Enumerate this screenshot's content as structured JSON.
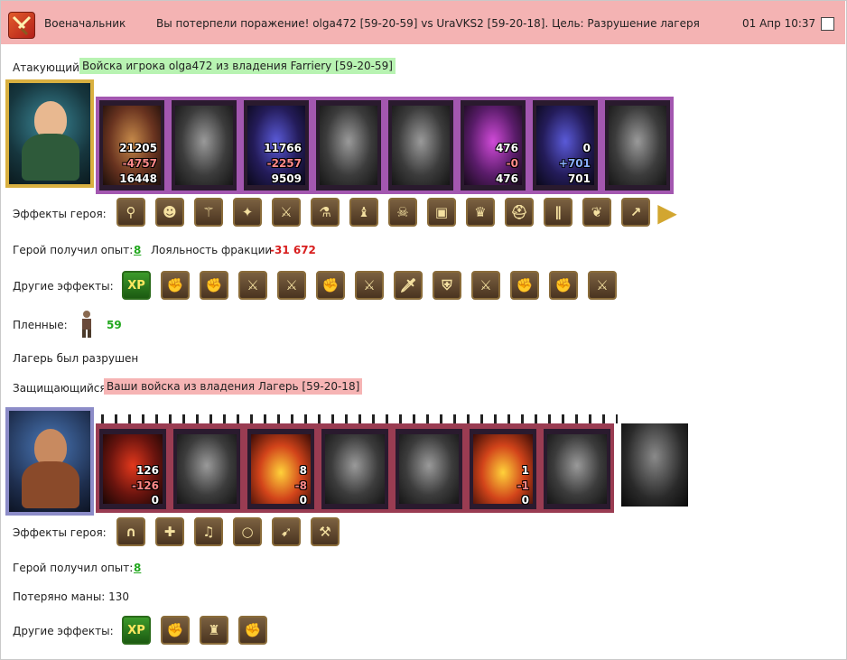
{
  "header": {
    "title": "Военачальник",
    "message": "Вы потерпели поражение! olga472 [59-20-59] vs UraVKS2 [59-20-18]. Цель: Разрушение лагеря",
    "time": "01 Апр 10:37"
  },
  "attacker": {
    "label": "Атакующий",
    "tag": "Войска игрока olga472 из владения Farriery [59-20-59]",
    "units": [
      {
        "icon": "ogre-unit-icon",
        "tone": "col",
        "a": "21205",
        "b": "-4757",
        "c": "16448"
      },
      {
        "icon": "dark-knight-unit-icon",
        "tone": "",
        "a": "",
        "b": "",
        "c": ""
      },
      {
        "icon": "dragon-rider-unit-icon",
        "tone": "blu",
        "a": "11766",
        "b": "-2257",
        "c": "9509"
      },
      {
        "icon": "griffin-unit-icon",
        "tone": "",
        "a": "",
        "b": "",
        "c": ""
      },
      {
        "icon": "archer-unit-icon",
        "tone": "",
        "a": "",
        "b": "",
        "c": ""
      },
      {
        "icon": "sorceress-unit-icon",
        "tone": "pur",
        "a": "476",
        "b": "-0",
        "c": "476"
      },
      {
        "icon": "assassin-unit-icon",
        "tone": "blu",
        "a": "0",
        "b": "+701",
        "c": "701"
      },
      {
        "icon": "horseman-unit-icon",
        "tone": "",
        "a": "",
        "b": "",
        "c": ""
      }
    ],
    "hero_effects_label": "Эффекты героя:",
    "hero_effects": [
      "boots-icon",
      "mask-icon",
      "staff-icon",
      "crystal-icon",
      "sword-icon",
      "potion-icon",
      "totem-icon",
      "skull-icon",
      "chest-icon",
      "crown-icon",
      "helm-icon",
      "legs-icon",
      "wings-icon",
      "spear-icon"
    ],
    "exp_label": "Герой получил опыт:",
    "exp_value": "8",
    "loyalty_label": "Лояльность фракции",
    "loyalty_value": "-31 672",
    "other_effects_label": "Другие эффекты:",
    "other_effects": [
      "xp",
      "fist-sword-icon",
      "fist-sword-icon",
      "sword-icon",
      "sword-icon",
      "fist-sword-icon",
      "sword-icon",
      "green-sword-icon",
      "shield-icon",
      "sword-icon",
      "fist-sword-icon",
      "fist-sword-icon",
      "sword-icon"
    ],
    "prisoners_label": "Пленные:",
    "prisoners_value": "59",
    "camp_text": "Лагерь был разрушен"
  },
  "defender": {
    "label": "Защищающийся",
    "tag": "Ваши войска из владения Лагерь [59-20-18]",
    "units": [
      {
        "icon": "red-demon-unit-icon",
        "tone": "red",
        "a": "126",
        "b": "-126",
        "c": "0"
      },
      {
        "icon": "skeleton-unit-icon",
        "tone": "",
        "a": "",
        "b": "",
        "c": ""
      },
      {
        "icon": "fire-beast-unit-icon",
        "tone": "fire",
        "a": "8",
        "b": "-8",
        "c": "0"
      },
      {
        "icon": "gargoyle-unit-icon",
        "tone": "",
        "a": "",
        "b": "",
        "c": ""
      },
      {
        "icon": "golem-unit-icon",
        "tone": "",
        "a": "",
        "b": "",
        "c": ""
      },
      {
        "icon": "fire-warrior-unit-icon",
        "tone": "fire",
        "a": "1",
        "b": "-1",
        "c": "0"
      },
      {
        "icon": "death-knight-unit-icon",
        "tone": "",
        "a": "",
        "b": "",
        "c": ""
      }
    ],
    "hero_effects_label": "Эффекты героя:",
    "hero_effects": [
      "hood-icon",
      "cross-icon",
      "bell-icon",
      "ring-icon",
      "crossbow-icon",
      "siege-icon"
    ],
    "exp_label": "Герой получил опыт:",
    "exp_value": "8",
    "mana_label": "Потеряно маны: 130",
    "other_effects_label": "Другие эффекты:",
    "other_effects": [
      "xp",
      "fist-sword-icon",
      "fortress-icon",
      "fist-sword-icon"
    ]
  },
  "xp_text": "XP"
}
